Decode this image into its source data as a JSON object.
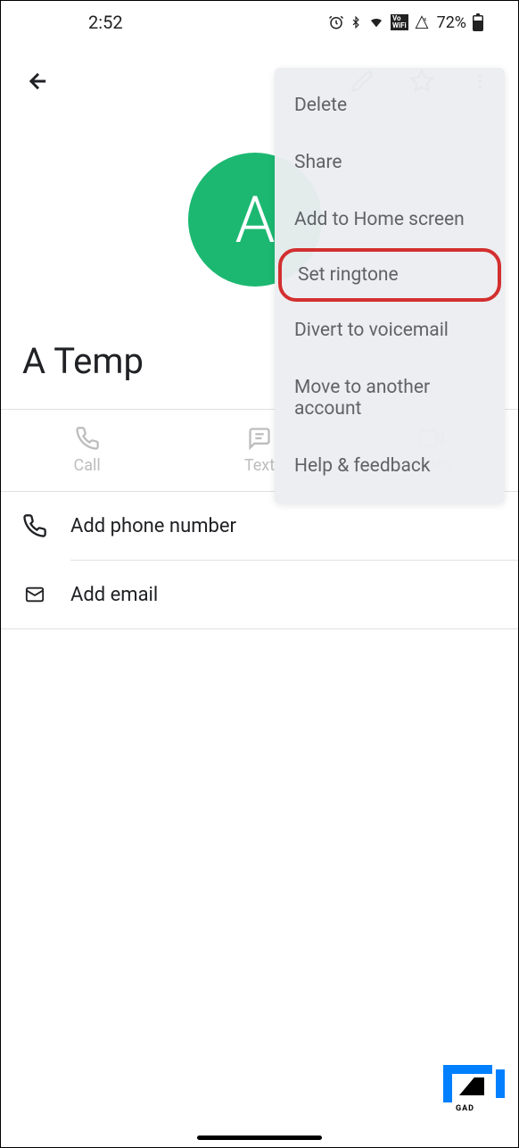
{
  "statusBar": {
    "time": "2:52",
    "batteryPercent": "72%"
  },
  "contact": {
    "avatarLetter": "A",
    "name": "A Temp"
  },
  "actions": {
    "call": "Call",
    "text": "Text",
    "video": "Video"
  },
  "infoRows": {
    "addPhone": "Add phone number",
    "addEmail": "Add email"
  },
  "menu": {
    "items": [
      "Delete",
      "Share",
      "Add to Home screen",
      "Set ringtone",
      "Divert to voicemail",
      "Move to another account",
      "Help & feedback"
    ]
  }
}
